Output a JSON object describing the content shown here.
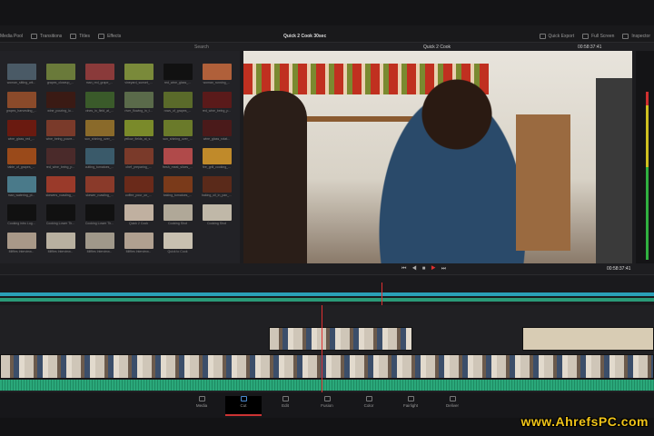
{
  "app": {
    "project_title": "Quick 2 Cook 30sec"
  },
  "toolbar": {
    "left": [
      "Media Pool",
      "Transitions",
      "Titles",
      "Effects"
    ],
    "right": [
      "Quick Export",
      "Full Screen",
      "Inspector"
    ]
  },
  "pool": {
    "search_label": "Search",
    "clips": [
      {
        "label": "woman_sitting_wit...",
        "color": "#4a5a66"
      },
      {
        "label": "grapes_closeup_...",
        "color": "#6a7a3a"
      },
      {
        "label": "man_red_grape_...",
        "color": "#8a3a3a"
      },
      {
        "label": "vineyard_sunset_...",
        "color": "#7a8a3a"
      },
      {
        "label": "red_wine_glass_...",
        "color": "#111111"
      },
      {
        "label": "woman_running_...",
        "color": "#b0603a"
      },
      {
        "label": "grapes_harvesting_...",
        "color": "#8a4a2a"
      },
      {
        "label": "wine_pouring_lo...",
        "color": "#3a1a14"
      },
      {
        "label": "vines_in_field_at_...",
        "color": "#3a5a2a"
      },
      {
        "label": "river_flowing_in_t...",
        "color": "#5a6a4a"
      },
      {
        "label": "rows_of_grapes_...",
        "color": "#5a6a2a"
      },
      {
        "label": "red_wine_being_p...",
        "color": "#5a1a1a"
      },
      {
        "label": "wine_glass_red_...",
        "color": "#6a1a10"
      },
      {
        "label": "wine_being_poure...",
        "color": "#7a3a2a"
      },
      {
        "label": "sun_shining_over_...",
        "color": "#8a6a2a"
      },
      {
        "label": "yellow_fields_at_s...",
        "color": "#7a8a2a"
      },
      {
        "label": "sun_shining_over_...",
        "color": "#6a7a2a"
      },
      {
        "label": "wine_glass_rotat...",
        "color": "#4a1a1a"
      },
      {
        "label": "table_of_grapes_...",
        "color": "#9a4a1a"
      },
      {
        "label": "red_wine_being_p...",
        "color": "#4a2a2a"
      },
      {
        "label": "cutting_tomatoes_...",
        "color": "#3a5a6a"
      },
      {
        "label": "chef_preparing_...",
        "color": "#7a3a2a"
      },
      {
        "label": "fresh_meat_slices_...",
        "color": "#b04a4a"
      },
      {
        "label": "fire_grill_cooking_...",
        "color": "#c08a2a"
      },
      {
        "label": "man_watering_pl...",
        "color": "#4a7a8a"
      },
      {
        "label": "skewers_roasting_...",
        "color": "#9a3a2a"
      },
      {
        "label": "skewer_roasting_...",
        "color": "#8a3a2a"
      },
      {
        "label": "coffee_pour_on_...",
        "color": "#6a2a1a"
      },
      {
        "label": "baking_tomatoes_...",
        "color": "#7a3a1a"
      },
      {
        "label": "baking_oil_in_pan_...",
        "color": "#5a2a1a"
      },
      {
        "label": "Cooking intro Log...",
        "color": "#111111"
      },
      {
        "label": "Cooking Lower Th...",
        "color": "#111111"
      },
      {
        "label": "Cooking Lower Th...",
        "color": "#111111"
      },
      {
        "label": "Quick 2 Cook",
        "color": "#c0b0a0"
      },
      {
        "label": "Cooking Shot",
        "color": "#b0a898"
      },
      {
        "label": "Cooking Shot",
        "color": "#c0b8a8"
      },
      {
        "label": "Miffies Interview...",
        "color": "#a89888"
      },
      {
        "label": "Miffies Interview...",
        "color": "#b8b0a0"
      },
      {
        "label": "Miffies Interview...",
        "color": "#a0988a"
      },
      {
        "label": "Miffies Interview...",
        "color": "#b0a090"
      },
      {
        "label": "Quick to Cook",
        "color": "#c8c0b0"
      }
    ]
  },
  "viewer": {
    "title": "Quick 2 Cook",
    "timecode": "00:58:37:41"
  },
  "pages": [
    {
      "label": "Media",
      "icon": "media-icon"
    },
    {
      "label": "Cut",
      "icon": "cut-icon",
      "active": true
    },
    {
      "label": "Edit",
      "icon": "edit-icon"
    },
    {
      "label": "Fusion",
      "icon": "fusion-icon"
    },
    {
      "label": "Color",
      "icon": "color-icon"
    },
    {
      "label": "Fairlight",
      "icon": "fairlight-icon"
    },
    {
      "label": "Deliver",
      "icon": "deliver-icon"
    }
  ],
  "colors": {
    "playhead": "#e03030",
    "audio": "#2aa87a",
    "tl_clip": "#2aa0b8"
  },
  "watermark": "www.AhrefsPC.com"
}
